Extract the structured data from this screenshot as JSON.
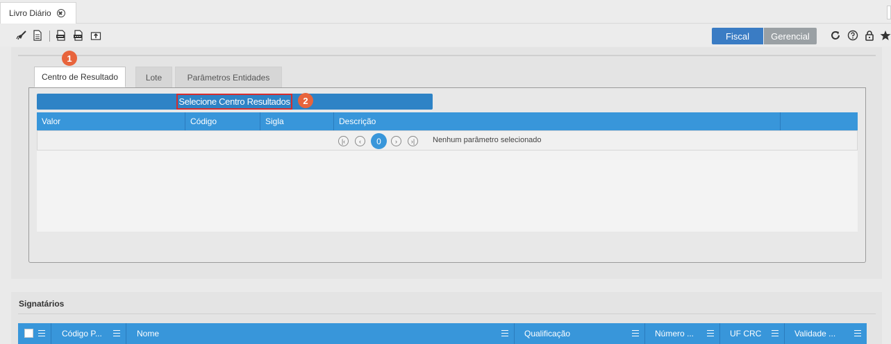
{
  "tabstrip": {
    "doc_tab_label": "Livro Diário"
  },
  "toolbar": {
    "icons": [
      "broom-icon",
      "document-icon",
      "csv-export-icon",
      "pdf-export-icon",
      "upload-icon"
    ],
    "fiscal_label": "Fiscal",
    "gerencial_label": "Gerencial",
    "right_icons": [
      "refresh-icon",
      "help-icon",
      "lock-icon",
      "star-icon"
    ]
  },
  "subtabs": [
    {
      "label": "Centro de Resultado",
      "active": true
    },
    {
      "label": "Lote",
      "active": false
    },
    {
      "label": "Parâmetros Entidades",
      "active": false
    }
  ],
  "select_button_label": "Selecione Centro Resultados",
  "badges": {
    "one": "1",
    "two": "2"
  },
  "grid": {
    "columns": [
      "Valor",
      "Código",
      "Sigla",
      "Descrição",
      ""
    ],
    "pager": {
      "current_page": "0",
      "status": "Nenhum parâmetro selecionado"
    },
    "rows": []
  },
  "signatarios": {
    "title": "Signatários",
    "columns": [
      "Código P...",
      "Nome",
      "Qualificação",
      "Número ...",
      "UF CRC",
      "Validade ..."
    ]
  },
  "colors": {
    "accent": "#3896da",
    "select_bar": "#2e83c6",
    "fiscal": "#3a7cc4",
    "gerencial": "#9aa0a4",
    "badge": "#e8643c",
    "highlight": "#d62c2c"
  }
}
